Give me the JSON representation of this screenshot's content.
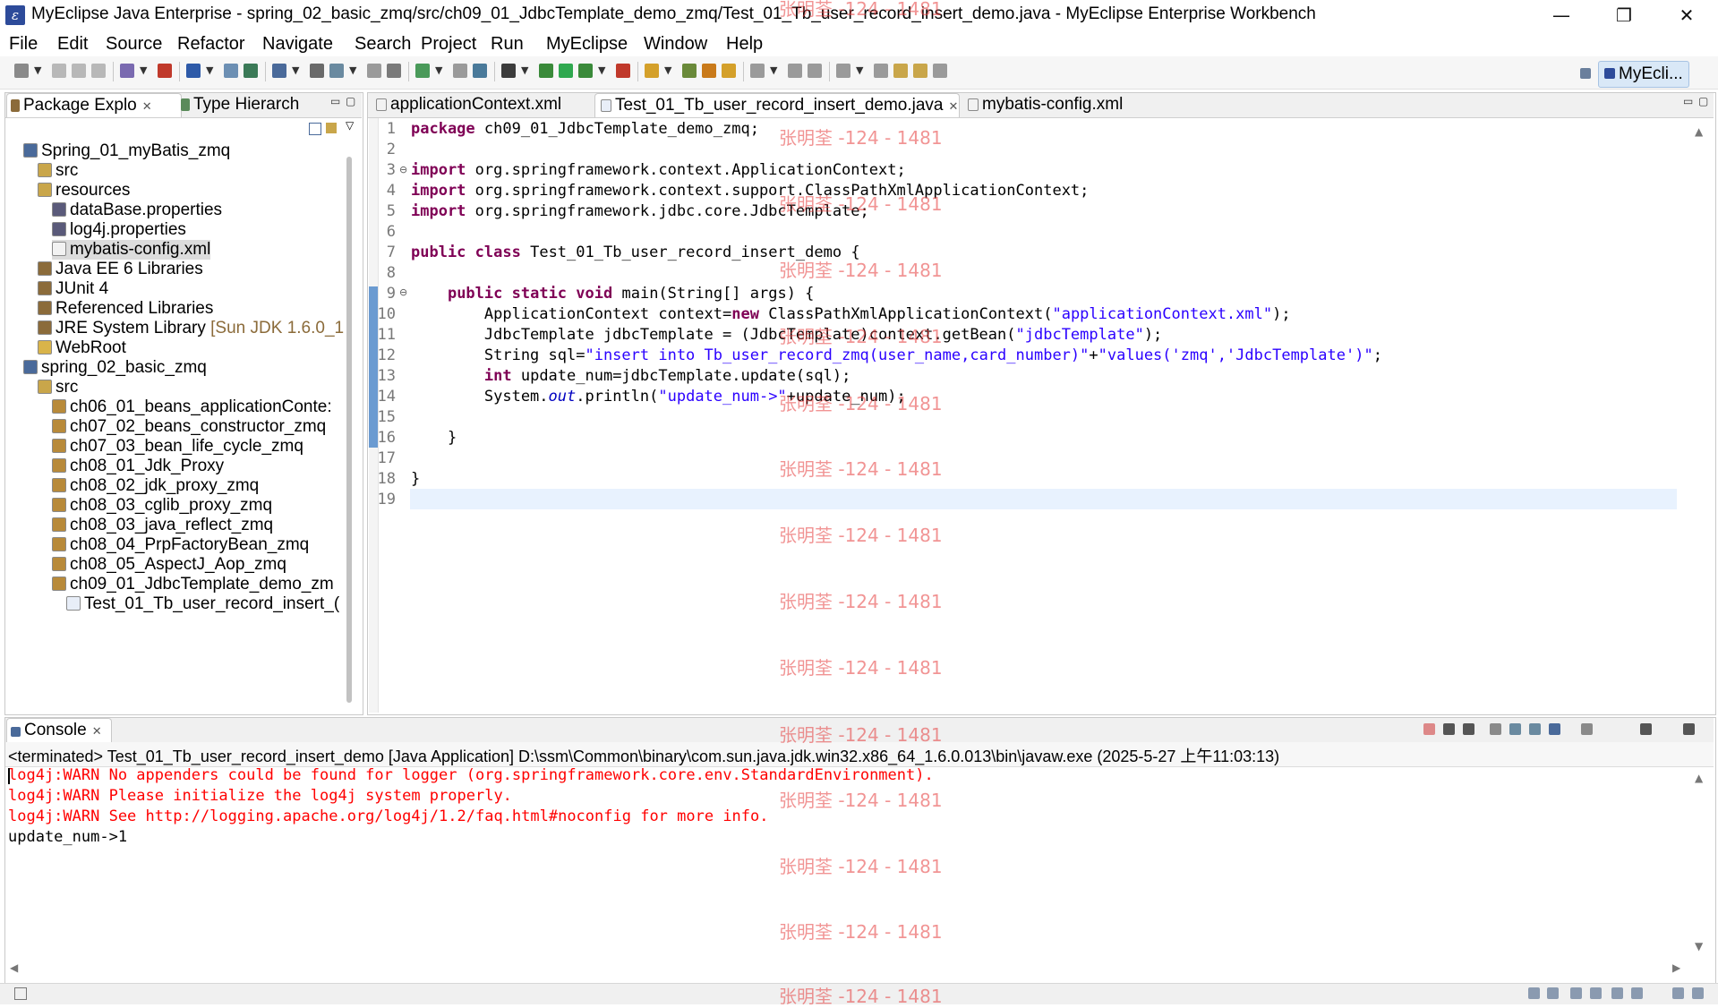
{
  "window": {
    "title": "MyEclipse Java Enterprise - spring_02_basic_zmq/src/ch09_01_JdbcTemplate_demo_zmq/Test_01_Tb_user_record_insert_demo.java - MyEclipse Enterprise Workbench",
    "minimize": "—",
    "maximize": "❐",
    "close": "✕"
  },
  "menu": [
    "File",
    "Edit",
    "Source",
    "Refactor",
    "Navigate",
    "Search",
    "Project",
    "Run",
    "MyEclipse",
    "Window",
    "Help"
  ],
  "perspective": {
    "label": "MyEcli..."
  },
  "explorer": {
    "tabs": [
      {
        "label": "Package Explo",
        "icon": "package-explorer-icon"
      },
      {
        "label": "Type Hierarch",
        "icon": "type-hierarchy-icon"
      }
    ],
    "items": [
      {
        "label": "Spring_01_myBatis_zmq",
        "depth": 0,
        "icon": "project-icon"
      },
      {
        "label": "src",
        "depth": 1,
        "icon": "source-folder-icon"
      },
      {
        "label": "resources",
        "depth": 1,
        "icon": "source-folder-icon"
      },
      {
        "label": "dataBase.properties",
        "depth": 2,
        "icon": "properties-file-icon"
      },
      {
        "label": "log4j.properties",
        "depth": 2,
        "icon": "properties-file-icon"
      },
      {
        "label": "mybatis-config.xml",
        "depth": 2,
        "icon": "xml-file-icon",
        "selected": true
      },
      {
        "label": "Java EE 6 Libraries",
        "depth": 1,
        "icon": "library-icon"
      },
      {
        "label": "JUnit 4",
        "depth": 1,
        "icon": "library-icon"
      },
      {
        "label": "Referenced Libraries",
        "depth": 1,
        "icon": "library-icon"
      },
      {
        "label": "JRE System Library",
        "suffix": " [Sun JDK 1.6.0_1",
        "depth": 1,
        "icon": "library-icon"
      },
      {
        "label": "WebRoot",
        "depth": 1,
        "icon": "folder-icon"
      },
      {
        "label": "spring_02_basic_zmq",
        "depth": 0,
        "icon": "project-icon"
      },
      {
        "label": "src",
        "depth": 1,
        "icon": "source-folder-icon"
      },
      {
        "label": "ch06_01_beans_applicationConte:",
        "depth": 2,
        "icon": "package-icon"
      },
      {
        "label": "ch07_02_beans_constructor_zmq",
        "depth": 2,
        "icon": "package-icon"
      },
      {
        "label": "ch07_03_bean_life_cycle_zmq",
        "depth": 2,
        "icon": "package-icon"
      },
      {
        "label": "ch08_01_Jdk_Proxy",
        "depth": 2,
        "icon": "package-icon"
      },
      {
        "label": "ch08_02_jdk_proxy_zmq",
        "depth": 2,
        "icon": "package-icon"
      },
      {
        "label": "ch08_03_cglib_proxy_zmq",
        "depth": 2,
        "icon": "package-icon"
      },
      {
        "label": "ch08_03_java_reflect_zmq",
        "depth": 2,
        "icon": "package-icon"
      },
      {
        "label": "ch08_04_PrpFactoryBean_zmq",
        "depth": 2,
        "icon": "package-icon"
      },
      {
        "label": "ch08_05_AspectJ_Aop_zmq",
        "depth": 2,
        "icon": "package-icon"
      },
      {
        "label": "ch09_01_JdbcTemplate_demo_zm",
        "depth": 2,
        "icon": "package-icon"
      },
      {
        "label": "Test_01_Tb_user_record_insert_(",
        "depth": 3,
        "icon": "java-file-icon"
      }
    ]
  },
  "editor": {
    "tabs": [
      {
        "label": "applicationContext.xml",
        "icon": "xml-file-icon",
        "active": false
      },
      {
        "label": "Test_01_Tb_user_record_insert_demo.java",
        "icon": "java-file-icon",
        "active": true
      },
      {
        "label": "mybatis-config.xml",
        "icon": "xml-file-icon",
        "active": false
      }
    ],
    "lines": [
      [
        [
          "kw",
          "package"
        ],
        [
          "t",
          " ch09_01_JdbcTemplate_demo_zmq;"
        ]
      ],
      [],
      [
        [
          "kw",
          "import"
        ],
        [
          "t",
          " org.springframework.context.ApplicationContext;"
        ]
      ],
      [
        [
          "kw",
          "import"
        ],
        [
          "t",
          " org.springframework.context.support.ClassPathXmlApplicationContext;"
        ]
      ],
      [
        [
          "kw",
          "import"
        ],
        [
          "t",
          " org.springframework.jdbc.core.JdbcTemplate;"
        ]
      ],
      [],
      [
        [
          "kw",
          "public"
        ],
        [
          "t",
          " "
        ],
        [
          "kw",
          "class"
        ],
        [
          "t",
          " Test_01_Tb_user_record_insert_demo {"
        ]
      ],
      [],
      [
        [
          "t",
          "    "
        ],
        [
          "kw",
          "public"
        ],
        [
          "t",
          " "
        ],
        [
          "kw",
          "static"
        ],
        [
          "t",
          " "
        ],
        [
          "kw",
          "void"
        ],
        [
          "t",
          " main(String[] args) {"
        ]
      ],
      [
        [
          "t",
          "        ApplicationContext context="
        ],
        [
          "kw",
          "new"
        ],
        [
          "t",
          " ClassPathXmlApplicationContext("
        ],
        [
          "str",
          "\"applicationContext.xml\""
        ],
        [
          "t",
          ");"
        ]
      ],
      [
        [
          "t",
          "        JdbcTemplate jdbcTemplate = (JdbcTemplate)context.getBean("
        ],
        [
          "str",
          "\"jdbcTemplate\""
        ],
        [
          "t",
          ");"
        ]
      ],
      [
        [
          "t",
          "        String sql="
        ],
        [
          "str",
          "\"insert into Tb_user_record_zmq(user_name,card_number)\""
        ],
        [
          "t",
          "+"
        ],
        [
          "str",
          "\"values('zmq','JdbcTemplate')\""
        ],
        [
          "t",
          ";"
        ]
      ],
      [
        [
          "t",
          "        "
        ],
        [
          "kw",
          "int"
        ],
        [
          "t",
          " update_num=jdbcTemplate.update(sql);"
        ]
      ],
      [
        [
          "t",
          "        System."
        ],
        [
          "fld",
          "out"
        ],
        [
          "t",
          ".println("
        ],
        [
          "str",
          "\"update_num->\""
        ],
        [
          "t",
          "+update_num);"
        ]
      ],
      [],
      [
        [
          "t",
          "    }"
        ]
      ],
      [],
      [
        [
          "t",
          "}"
        ]
      ],
      []
    ]
  },
  "console": {
    "tab_label": "Console",
    "header": "<terminated> Test_01_Tb_user_record_insert_demo [Java Application] D:\\ssm\\Common\\binary\\com.sun.java.jdk.win32.x86_64_1.6.0.013\\bin\\javaw.exe (2025-5-27 上午11:03:13)",
    "lines": [
      {
        "text": "log4j:WARN No appenders could be found for logger (org.springframework.core.env.StandardEnvironment).",
        "error": true
      },
      {
        "text": "log4j:WARN Please initialize the log4j system properly.",
        "error": true
      },
      {
        "text": "log4j:WARN See http://logging.apache.org/log4j/1.2/faq.html#noconfig for more info.",
        "error": true
      },
      {
        "text": "update_num->1",
        "error": false
      }
    ]
  },
  "watermark": {
    "text": "张明荃 -124 - 1481",
    "count": 16
  },
  "colors": {
    "keyword": "#7f0055",
    "string": "#2a00ff",
    "error": "#ff0000",
    "watermark": "#e63c3c",
    "current_line": "#e8f2fe"
  }
}
